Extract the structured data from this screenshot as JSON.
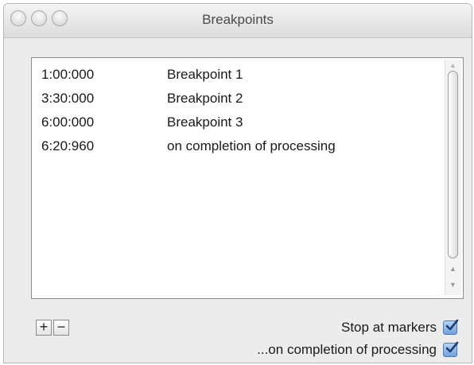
{
  "window": {
    "title": "Breakpoints"
  },
  "breakpoints": [
    {
      "time": "1:00:000",
      "label": "Breakpoint 1"
    },
    {
      "time": "3:30:000",
      "label": "Breakpoint 2"
    },
    {
      "time": "6:00:000",
      "label": "Breakpoint 3"
    },
    {
      "time": "6:20:960",
      "label": "on completion of processing"
    }
  ],
  "buttons": {
    "add": "+",
    "remove": "−"
  },
  "options": {
    "stop_at_markers": {
      "label": "Stop at markers",
      "checked": true
    },
    "on_completion": {
      "label": "...on completion of processing",
      "checked": true
    }
  },
  "colors": {
    "checkbox_accent": "#6fa1dd"
  }
}
